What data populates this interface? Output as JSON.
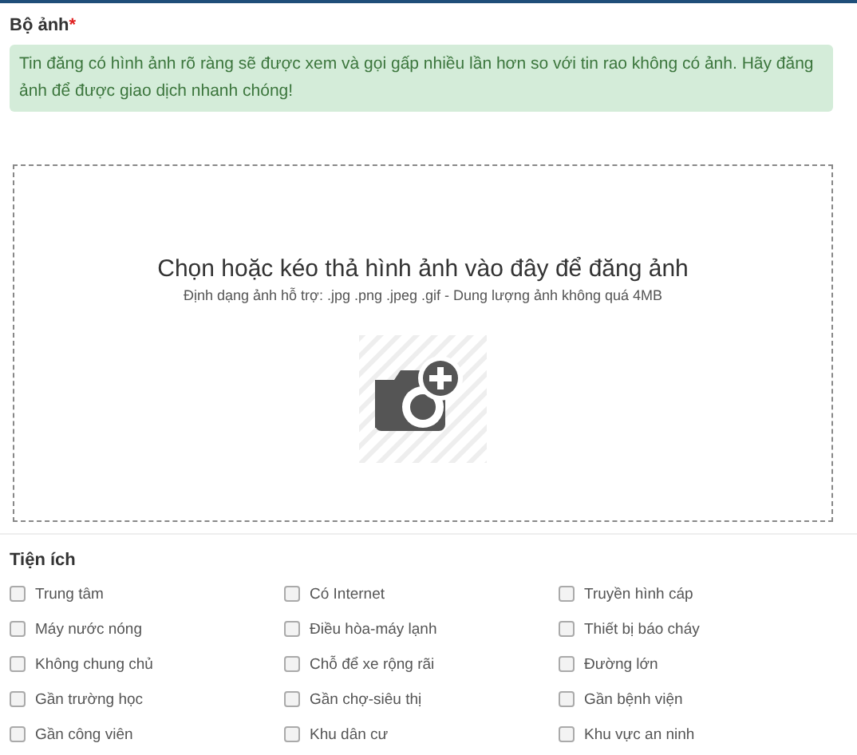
{
  "photos": {
    "label": "Bộ ảnh",
    "required_mark": "*",
    "notice": "Tin đăng có hình ảnh rõ ràng sẽ được xem và gọi gấp nhiều lần hơn so với tin rao không có ảnh. Hãy đăng ảnh để được giao dịch nhanh chóng!",
    "dropzone": {
      "title": "Chọn hoặc kéo thả hình ảnh vào đây để đăng ảnh",
      "hint": "Định dạng ảnh hỗ trợ: .jpg .png .jpeg .gif - Dung lượng ảnh không quá 4MB"
    }
  },
  "amenities": {
    "title": "Tiện ích",
    "items": [
      {
        "label": "Trung tâm",
        "checked": false
      },
      {
        "label": "Có Internet",
        "checked": false
      },
      {
        "label": "Truyền hình cáp",
        "checked": false
      },
      {
        "label": "Máy nước nóng",
        "checked": false
      },
      {
        "label": "Điều hòa-máy lạnh",
        "checked": false
      },
      {
        "label": "Thiết bị báo cháy",
        "checked": false
      },
      {
        "label": "Không chung chủ",
        "checked": false
      },
      {
        "label": "Chỗ để xe rộng rãi",
        "checked": false
      },
      {
        "label": "Đường lớn",
        "checked": false
      },
      {
        "label": "Gần trường học",
        "checked": false
      },
      {
        "label": "Gần chợ-siêu thị",
        "checked": false
      },
      {
        "label": "Gần bệnh viện",
        "checked": false
      },
      {
        "label": "Gần công viên",
        "checked": false
      },
      {
        "label": "Khu dân cư",
        "checked": false
      },
      {
        "label": "Khu vực an ninh",
        "checked": false
      }
    ]
  }
}
